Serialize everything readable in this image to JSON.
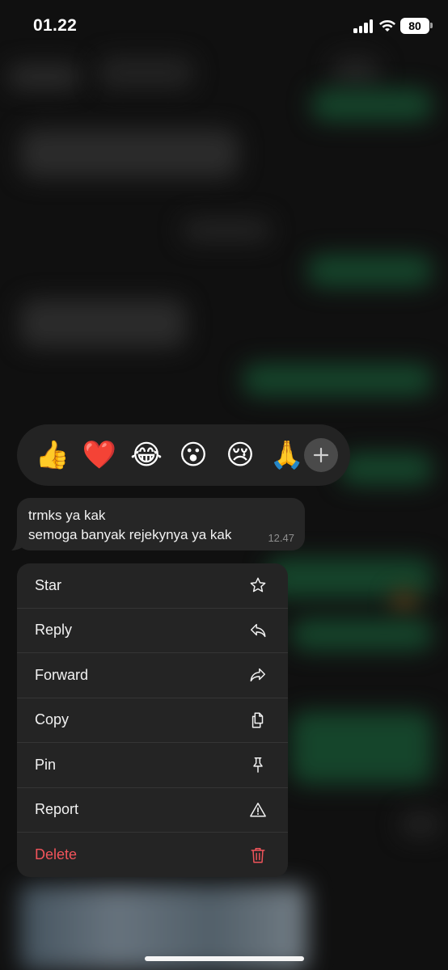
{
  "status_bar": {
    "time": "01.22",
    "battery_level": "80",
    "signal_icon": "cellular-signal-icon",
    "wifi_icon": "wifi-icon"
  },
  "reactions": [
    {
      "emoji": "👍",
      "name": "thumbs-up"
    },
    {
      "emoji": "❤️",
      "name": "heart"
    },
    {
      "emoji": "😂",
      "name": "tears-of-joy"
    },
    {
      "emoji": "😮",
      "name": "surprised"
    },
    {
      "emoji": "😢",
      "name": "crying"
    },
    {
      "emoji": "🙏",
      "name": "praying-hands"
    }
  ],
  "more_reactions_icon": "plus-icon",
  "message": {
    "line1": "trmks ya kak",
    "line2": "semoga banyak rejekynya ya kak",
    "time": "12.47"
  },
  "menu": {
    "items": [
      {
        "label": "Star",
        "icon": "star-icon"
      },
      {
        "label": "Reply",
        "icon": "reply-icon"
      },
      {
        "label": "Forward",
        "icon": "forward-icon"
      },
      {
        "label": "Copy",
        "icon": "copy-icon"
      },
      {
        "label": "Pin",
        "icon": "pin-icon"
      },
      {
        "label": "Report",
        "icon": "warning-icon"
      },
      {
        "label": "Delete",
        "icon": "trash-icon"
      }
    ]
  },
  "colors": {
    "danger": "#f2545b",
    "bubble": "#262626",
    "menu_bg": "#242424"
  }
}
